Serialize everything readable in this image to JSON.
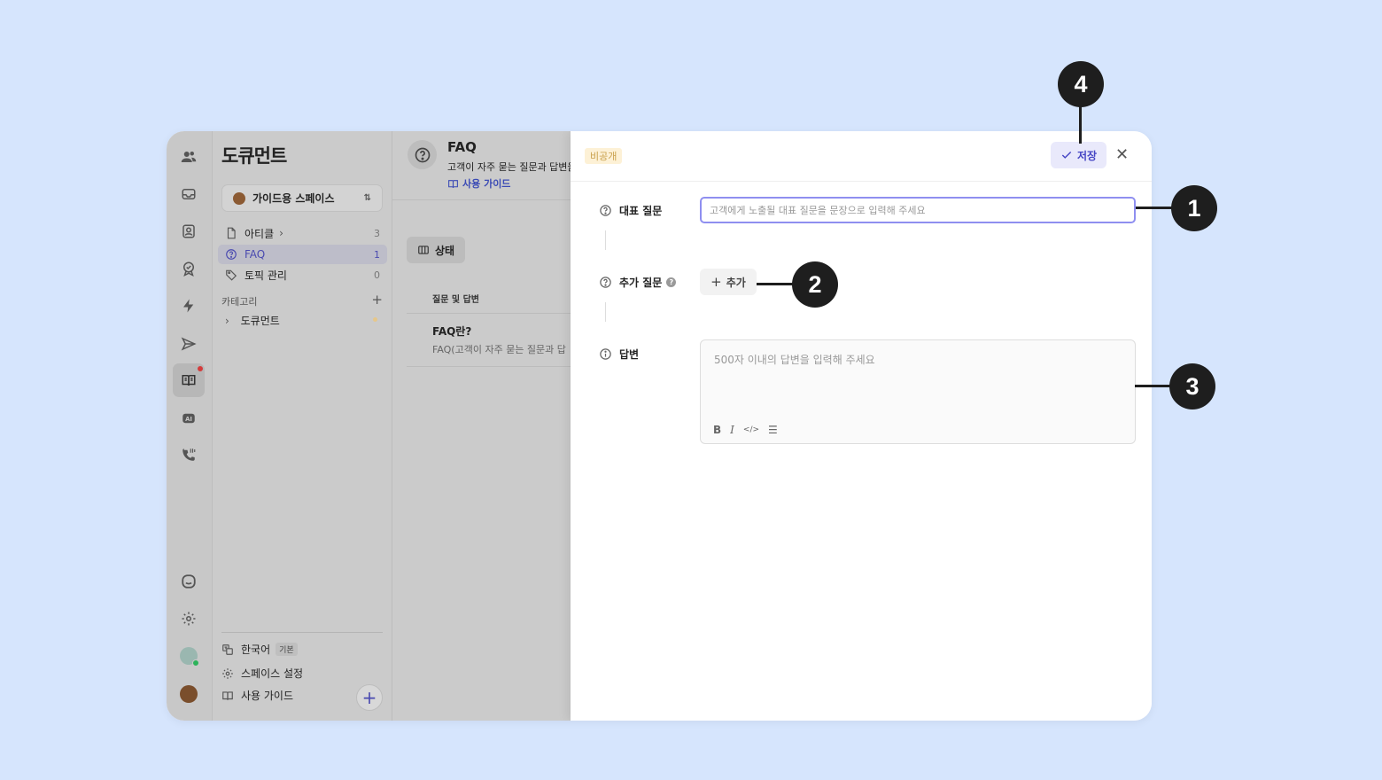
{
  "sidebar": {
    "title": "도큐먼트",
    "space_name": "가이드용 스페이스",
    "nav": [
      {
        "label": "아티클",
        "count": "3"
      },
      {
        "label": "FAQ",
        "count": "1"
      },
      {
        "label": "토픽 관리",
        "count": "0"
      }
    ],
    "category_label": "카테고리",
    "category_item": "도큐먼트",
    "language": "한국어",
    "language_badge": "기본",
    "space_settings": "스페이스 설정",
    "user_guide": "사용 가이드"
  },
  "content": {
    "title": "FAQ",
    "description": "고객이 자주 묻는 질문과 답변을",
    "guide_link": "사용 가이드",
    "status_button": "상태",
    "column_header": "질문 및 답변",
    "row_title": "FAQ란?",
    "row_desc": "FAQ(고객이 자주 묻는 질문과 답"
  },
  "panel": {
    "visibility_badge": "비공개",
    "save_label": "저장",
    "close_glyph": "✕",
    "question_label": "대표 질문",
    "question_placeholder": "고객에게 노출될 대표 질문을 문장으로 입력해 주세요",
    "extra_label": "추가 질문",
    "add_label": "추가",
    "answer_label": "답변",
    "answer_placeholder": "500자 이내의 답변을 입력해 주세요",
    "toolbar": [
      "B",
      "I",
      "</>",
      "☰"
    ]
  },
  "callouts": [
    "1",
    "2",
    "3",
    "4"
  ]
}
